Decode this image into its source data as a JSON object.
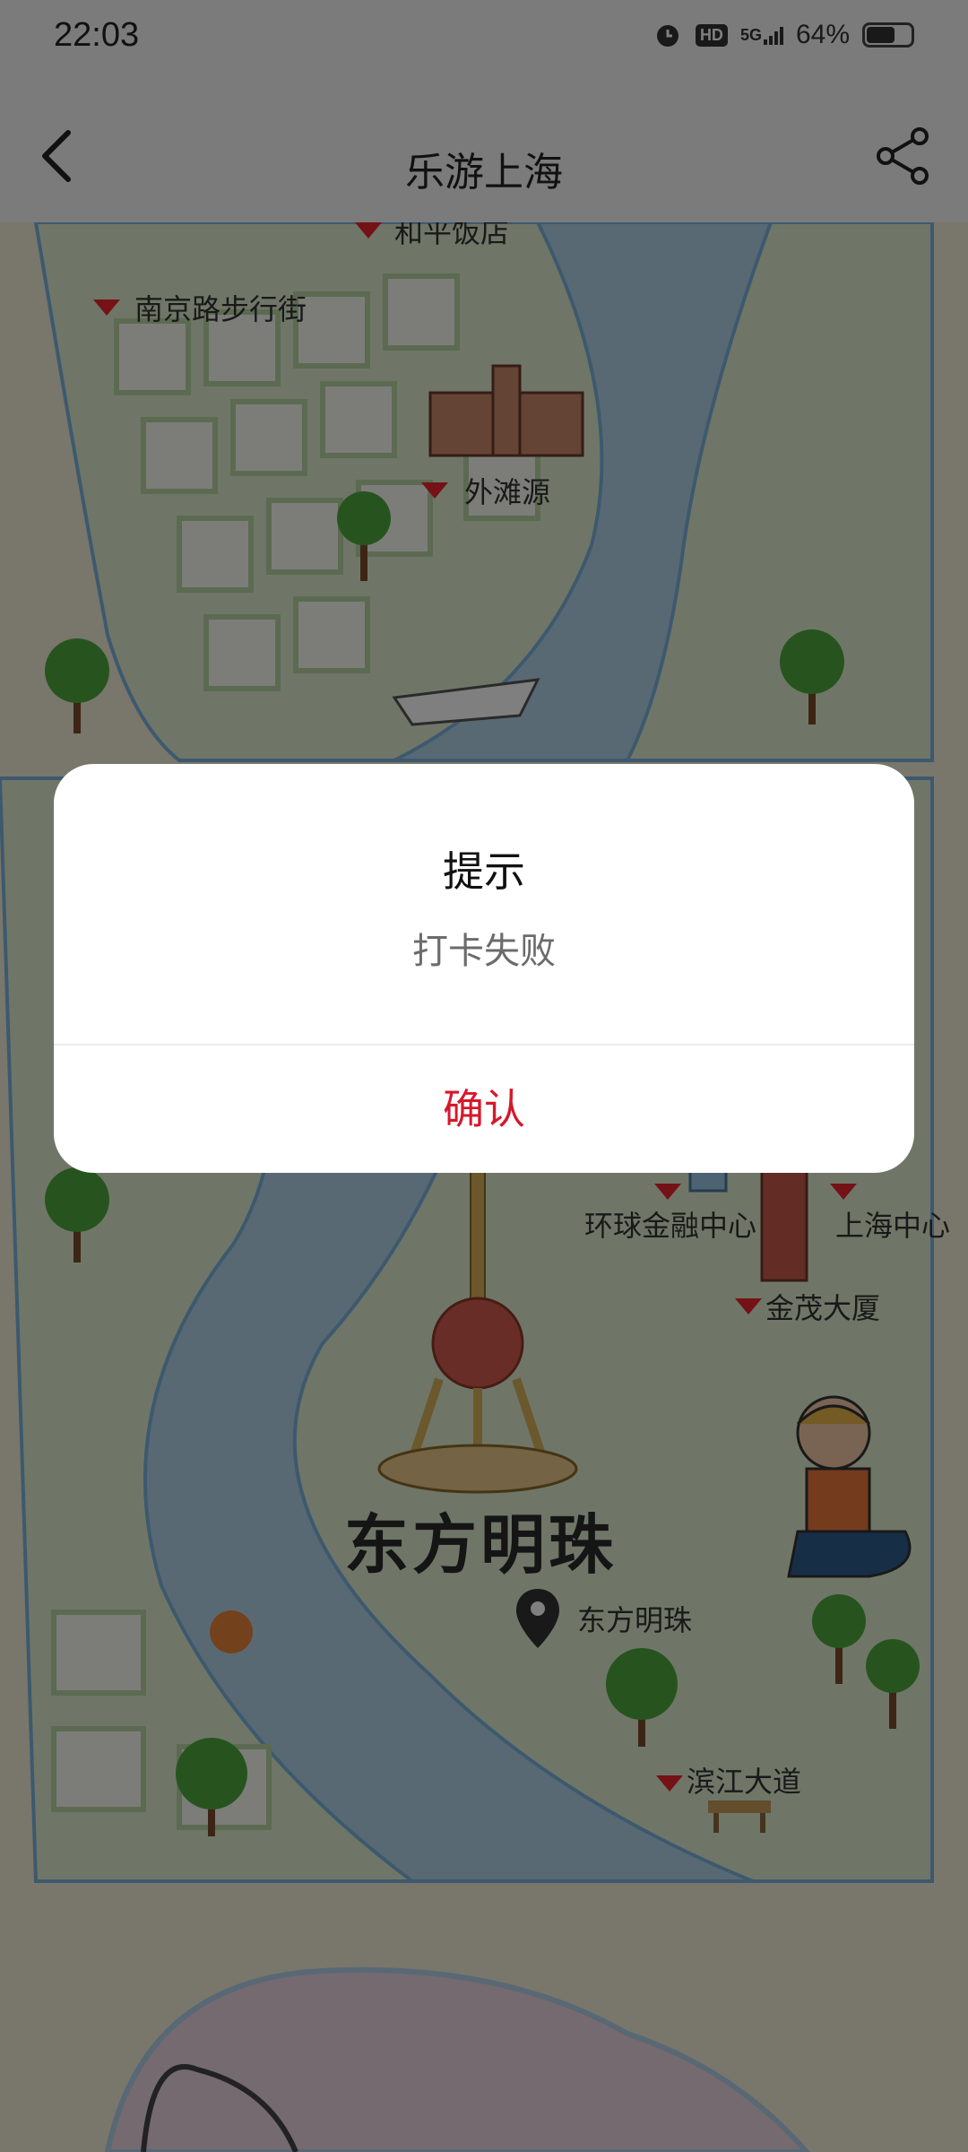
{
  "status_bar": {
    "time": "22:03",
    "network": "5G",
    "hd_badge": "HD",
    "battery_percent": "64%",
    "battery_level": 0.64,
    "icons": [
      "alarm-icon",
      "hd-icon",
      "signal-5g-icon",
      "battery-icon"
    ]
  },
  "nav": {
    "title": "乐游上海",
    "back_icon": "back-arrow-icon",
    "share_icon": "share-icon"
  },
  "map": {
    "labels": {
      "peace_hotel": "和平饭店",
      "nanjing_road": "南京路步行街",
      "bund_origin": "外滩源",
      "swfc": "环球金融中心",
      "shanghai_tower": "上海中心",
      "jinmao": "金茂大厦",
      "oriental_pearl_big": "东方明珠",
      "oriental_pearl_pin": "东方明珠",
      "riverside_avenue": "滨江大道"
    },
    "colors": {
      "river": "#b3d3e9",
      "land": "#dfeccf",
      "sand": "#f3ecd6",
      "marker": "#e8242a"
    }
  },
  "dialog": {
    "title": "提示",
    "message": "打卡失败",
    "confirm_label": "确认",
    "confirm_color": "#d6182b"
  }
}
